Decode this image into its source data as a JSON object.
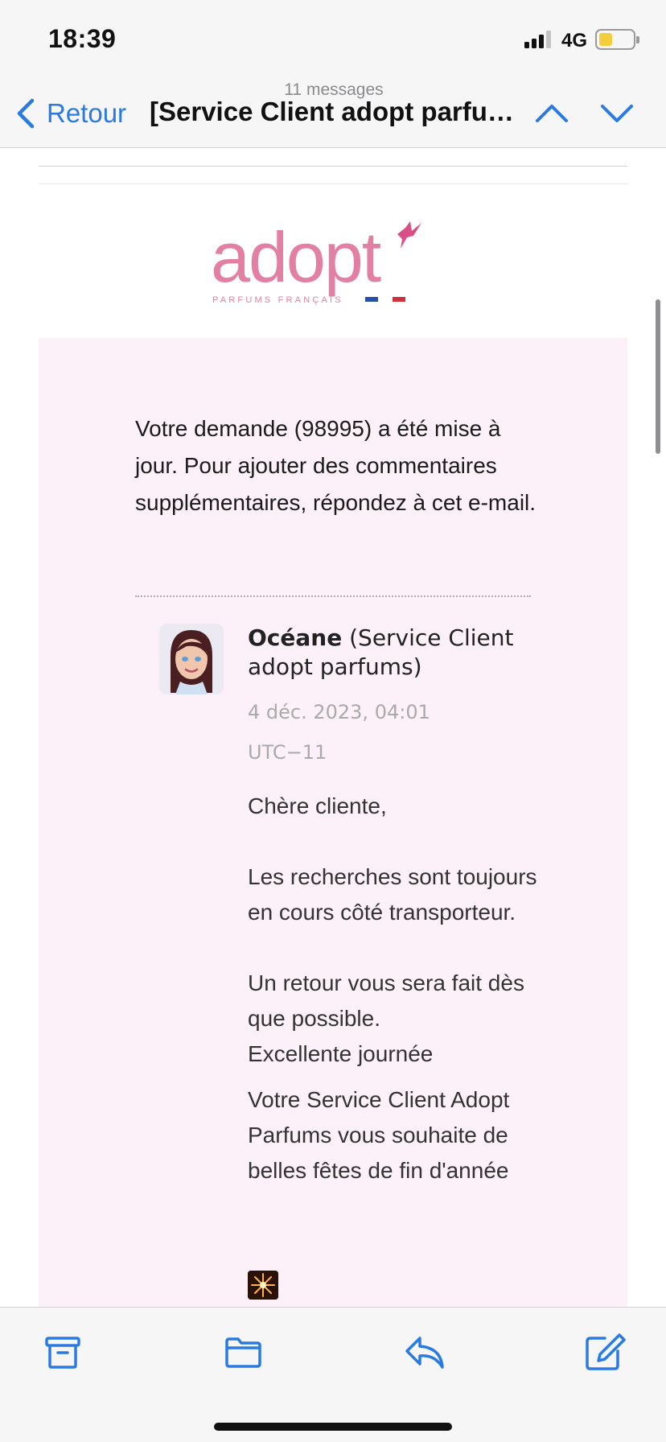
{
  "status": {
    "time": "18:39",
    "network": "4G",
    "battery_level": 0.25
  },
  "nav": {
    "back_label": "Retour",
    "message_count": "11 messages",
    "title": "[Service Client adopt parfums] Re: Colis",
    "title_display": "[Service Client adopt parfu…"
  },
  "logo": {
    "brand": "adopt",
    "tagline": "PARFUMS FRANÇAIS",
    "brand_color": "#e27fa2"
  },
  "email": {
    "intro": "Votre demande (98995) a été mise à jour. Pour ajouter des commentaires supplémentaires, répondez à cet e-mail.",
    "author_name": "Océane",
    "author_org": " (Service Client adopt parfums)",
    "date": "4 déc. 2023, 04:01",
    "timezone": "UTC−11",
    "greeting": "Chère cliente,",
    "paragraph1": "Les recherches sont toujours en cours côté transporteur.",
    "paragraph2": "Un retour vous sera fait dès que possible.",
    "closing": "Excellente journée",
    "signature": "Votre Service Client Adopt Parfums vous souhaite de belles fêtes de fin d'année"
  },
  "toolbar": {
    "archive": "archive-icon",
    "move": "folder-icon",
    "reply": "reply-icon",
    "compose": "compose-icon"
  },
  "colors": {
    "accent": "#2a7ae2",
    "panel_bg": "#fcf0f9",
    "chrome_bg": "#f6f6f7"
  }
}
